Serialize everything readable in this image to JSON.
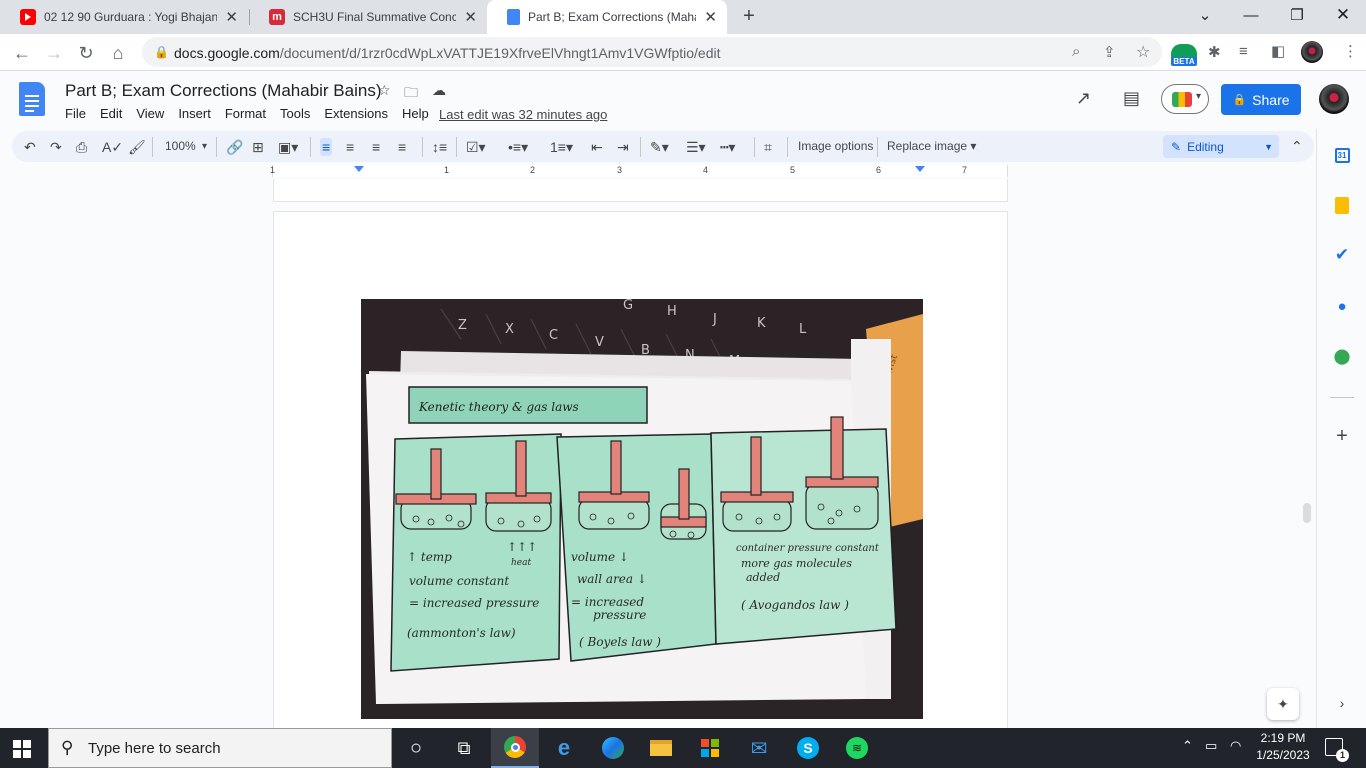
{
  "browser": {
    "tabs": [
      {
        "title": "02 12 90 Gurduara : Yogi Bhajan | ",
        "icon": "youtube-icon",
        "color": "#ff0000",
        "active": false
      },
      {
        "title": "SCH3U Final Summative Concept",
        "icon": "mindmeister-icon",
        "color": "#d62b3a",
        "active": false
      },
      {
        "title": "Part B; Exam Corrections (Mahab",
        "icon": "google-docs-icon",
        "color": "#4285f4",
        "active": true
      }
    ],
    "new_tab": "+",
    "url_host": "docs.google.com",
    "url_path": "/document/d/1rzr0cdWpLxVATTJE19XfrveElVhngt1Amv1VGWfptio/edit",
    "beta_label": "BETA"
  },
  "docs": {
    "title": "Part B; Exam Corrections (Mahabir Bains)",
    "menu": [
      "File",
      "Edit",
      "View",
      "Insert",
      "Format",
      "Tools",
      "Extensions",
      "Help"
    ],
    "last_edit": "Last edit was 32 minutes ago",
    "share_label": "Share",
    "toolbar": {
      "zoom": "100%",
      "image_options": "Image options",
      "replace_image": "Replace image",
      "mode": "Editing"
    },
    "ruler_numbers": [
      "1",
      "1",
      "2",
      "3",
      "4",
      "5",
      "6",
      "7"
    ]
  },
  "photo": {
    "heading": "Kenetic theory & gas laws",
    "keys": [
      "Z",
      "X",
      "C",
      "V",
      "B",
      "N",
      "M",
      "G",
      "H",
      "J",
      "K",
      "L"
    ],
    "sticky_label": "Twist",
    "panel1": {
      "lines": [
        "↑ temp",
        "↑↑↑",
        "heat",
        "volume constant",
        "= increased pressure",
        "(ammonton's law)"
      ]
    },
    "panel2": {
      "lines": [
        "volume ↓",
        "wall area ↓",
        "= increased",
        "pressure",
        "( Boyels law )"
      ]
    },
    "panel3": {
      "lines": [
        "container pressure constant",
        "more gas molecules",
        "added",
        "( Avogandos law )"
      ]
    }
  },
  "taskbar": {
    "search_placeholder": "Type here to search",
    "time": "2:19 PM",
    "date": "1/25/2023",
    "notification_count": "1"
  }
}
